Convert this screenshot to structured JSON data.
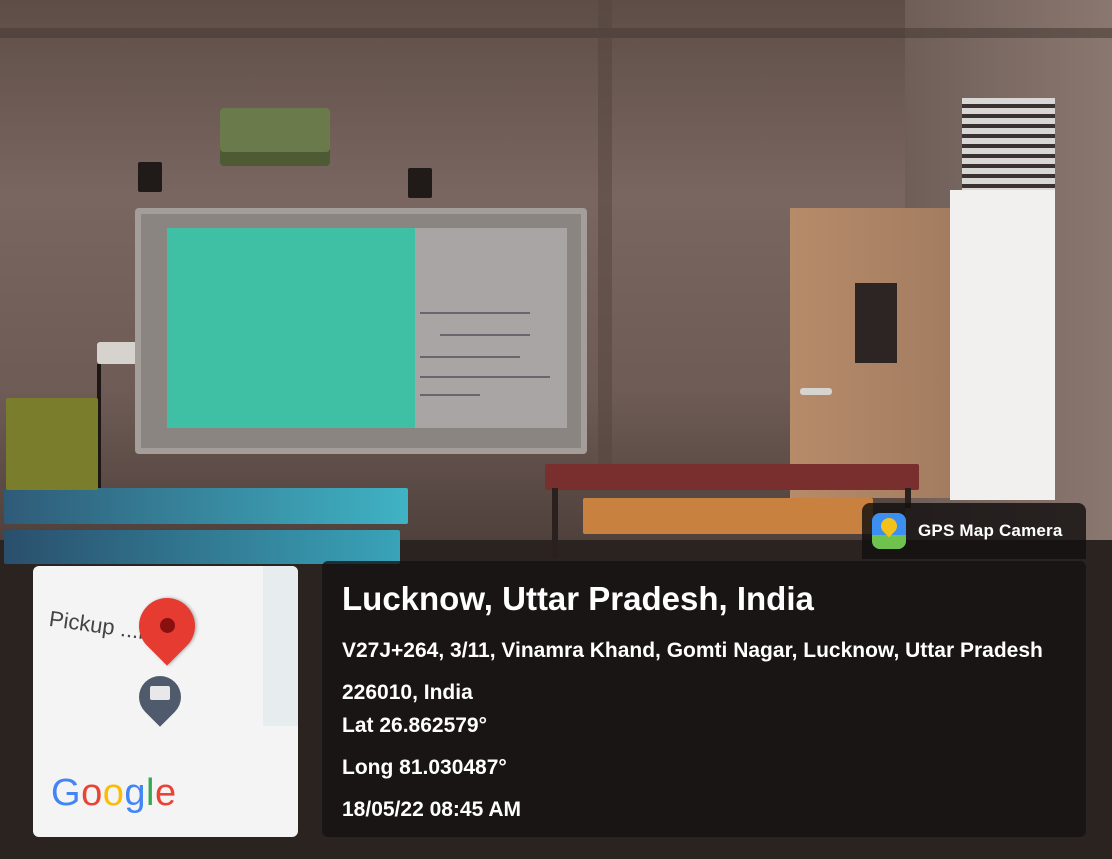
{
  "badge": {
    "label": "GPS Map Camera",
    "icon": "gps-map-camera-app-icon"
  },
  "location": {
    "title": "Lucknow, Uttar Pradesh, India",
    "address": "V27J+264, 3/11, Vinamra Khand, Gomti Nagar, Lucknow, Uttar Pradesh 226010, India",
    "latitude": "Lat 26.862579°",
    "longitude": "Long 81.030487°",
    "timestamp": "18/05/22 08:45 AM"
  },
  "map": {
    "street_label": "Pickup ...rd",
    "brand": "Google",
    "brand_letters": [
      "G",
      "o",
      "o",
      "g",
      "l",
      "e"
    ],
    "brand_colors": [
      "#4285F4",
      "#EA4335",
      "#FBBC05",
      "#4285F4",
      "#34A853",
      "#EA4335"
    ],
    "pin_icon": "map-pin-icon",
    "place_icon": "place-marker-icon"
  },
  "colors": {
    "board_green": "#3fc0a4",
    "pin_red": "#e53b30",
    "overlay": "#141212"
  }
}
